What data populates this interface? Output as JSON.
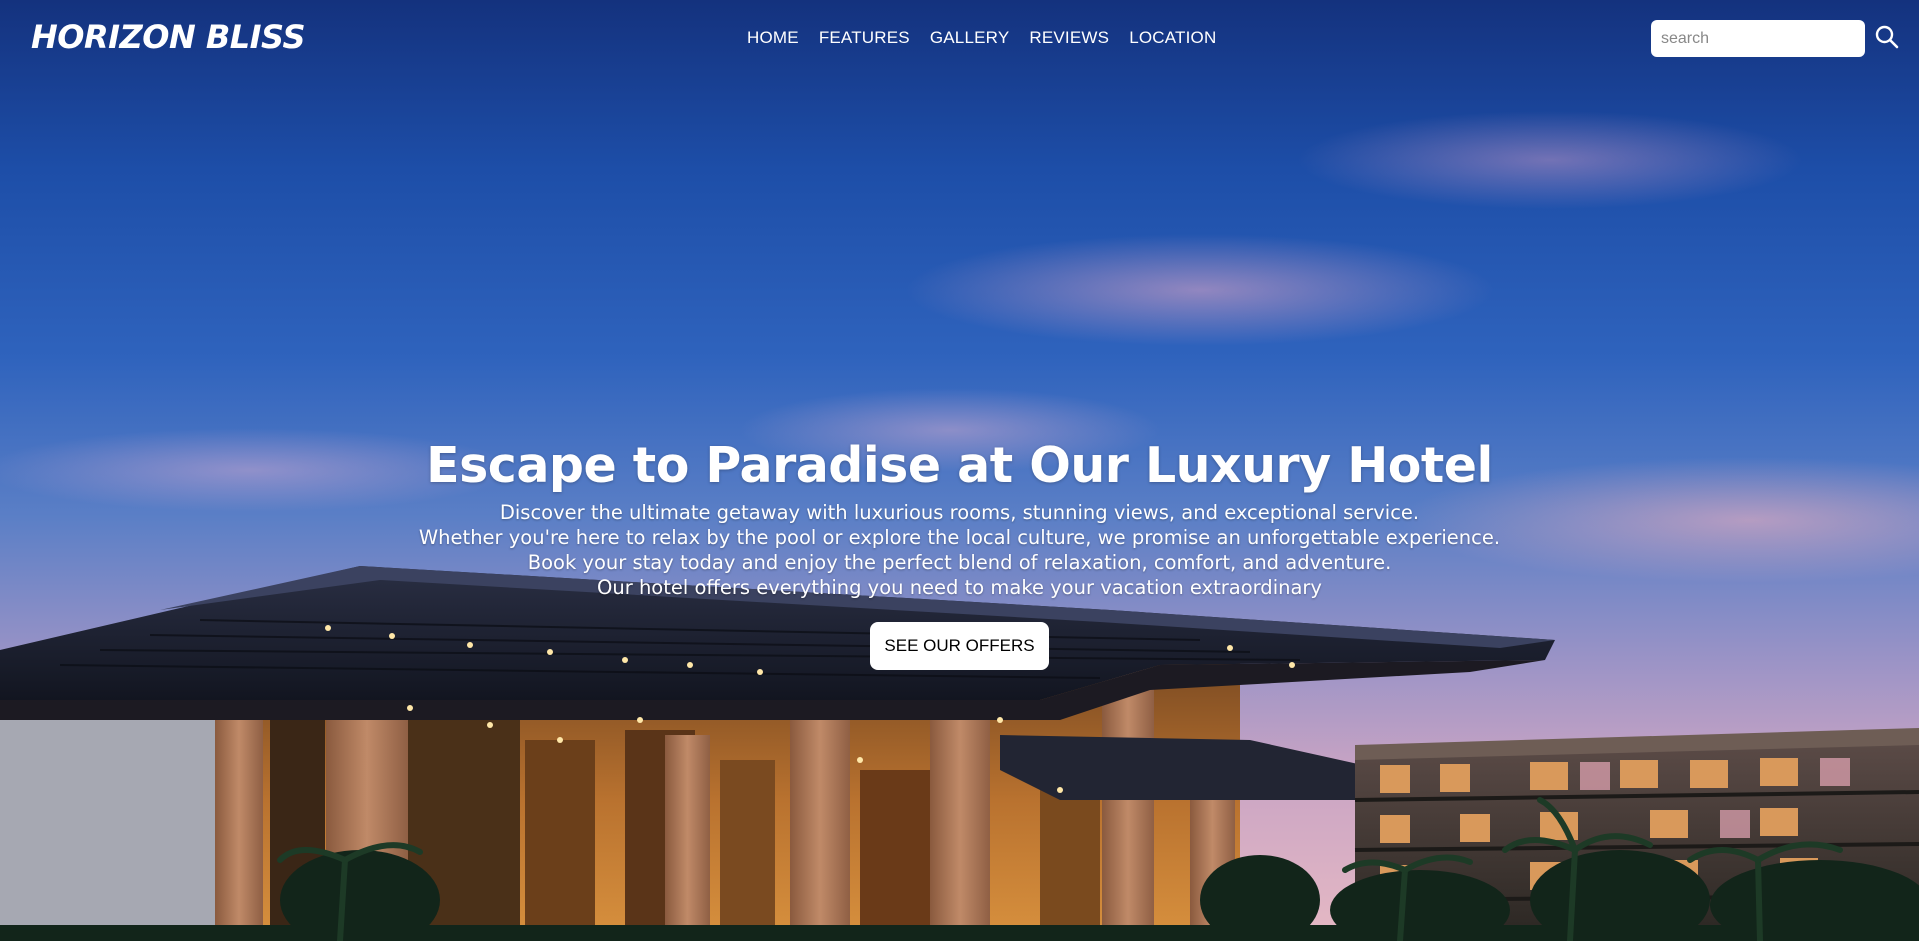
{
  "brand": {
    "name": "HORIZON BLISS"
  },
  "nav": {
    "items": [
      {
        "label": "HOME"
      },
      {
        "label": "FEATURES"
      },
      {
        "label": "GALLERY"
      },
      {
        "label": "REVIEWS"
      },
      {
        "label": "LOCATION"
      }
    ]
  },
  "search": {
    "placeholder": "search",
    "value": "",
    "icon": "search-icon"
  },
  "hero": {
    "title": "Escape to Paradise at Our Luxury Hotel",
    "lines": [
      "Discover the ultimate getaway with luxurious rooms, stunning views, and exceptional service.",
      "Whether you're here to relax by the pool or explore the local culture, we promise an unforgettable experience.",
      "Book your stay today and enjoy the perfect blend of relaxation, comfort, and adventure.",
      "Our hotel offers everything you need to make your vacation extraordinary"
    ],
    "cta_label": "SEE OUR OFFERS"
  },
  "colors": {
    "sky_top": "#14327e",
    "sky_mid": "#2f63bd",
    "sky_horizon": "#e6b9c4",
    "text": "#ffffff",
    "button_bg": "#ffffff",
    "button_text": "#000000"
  }
}
